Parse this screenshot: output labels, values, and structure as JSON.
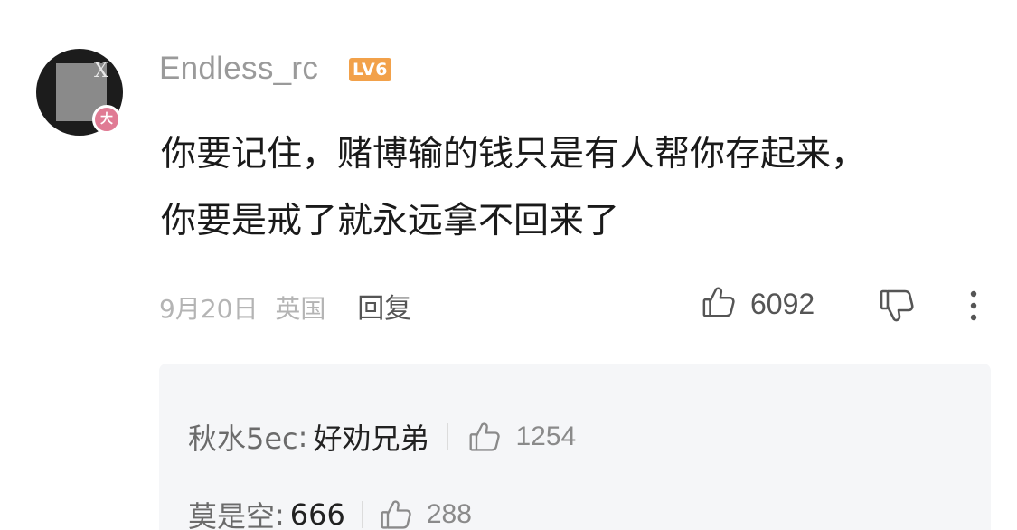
{
  "comment": {
    "username": "Endless_rc",
    "level_badge": "LV6",
    "avatar_badge": "大",
    "avatar_mark": "X",
    "text_lines": [
      "你要记住，赌博输的钱只是有人帮你存起来，",
      "你要是戒了就永远拿不回来了"
    ],
    "date": "9月20日",
    "region": "英国",
    "reply_label": "回复",
    "like_count": "6092",
    "icons": {
      "like": "thumbs-up-icon",
      "dislike": "thumbs-down-icon",
      "more": "more-vertical-icon"
    }
  },
  "replies": [
    {
      "user": "秋水5ec",
      "text": "好劝兄弟",
      "like_count": "1254"
    },
    {
      "user": "莫是空",
      "text": "666",
      "like_count": "288"
    }
  ],
  "colors": {
    "username": "#9a9a9a",
    "level_badge_bg": "#f2a14a",
    "avatar_badge_bg": "#e07b94",
    "reply_panel_bg": "#f5f6f8"
  }
}
